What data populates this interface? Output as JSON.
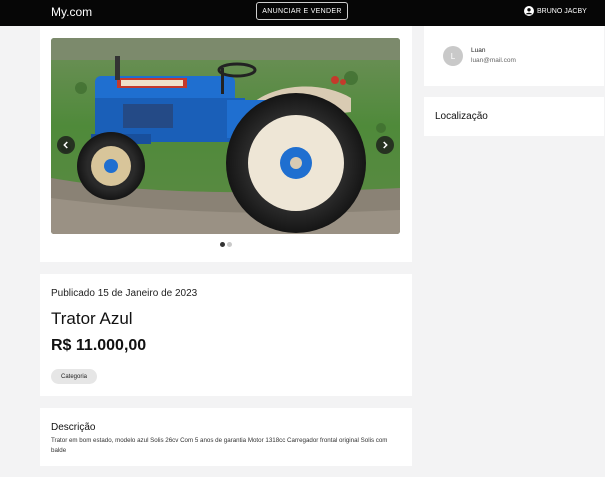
{
  "header": {
    "brand": "My.com",
    "sell_button": "ANUNCIAR E VENDER",
    "user_name": "BRUNO JACBY"
  },
  "gallery": {
    "image_subject": "blue-tractor",
    "slide_count": 2,
    "active_slide": 1
  },
  "listing": {
    "published": "Publicado 15 de Janeiro de 2023",
    "title": "Trator Azul",
    "price": "R$ 11.000,00",
    "category": "Categoria"
  },
  "description": {
    "heading": "Descrição",
    "text": "Trator em bom estado, modelo azul Solis 26cv Com 5 anos de garantia Motor 1318cc Carregador frontal original Solis com balde"
  },
  "seller": {
    "initial": "L",
    "name": "Luan",
    "email": "luan@mail.com"
  },
  "location": {
    "heading": "Localização"
  },
  "colors": {
    "topbar": "#060606",
    "page_bg": "#f3f3f4",
    "tractor_blue": "#1f6fd0",
    "grass": "#4f8a3a"
  }
}
